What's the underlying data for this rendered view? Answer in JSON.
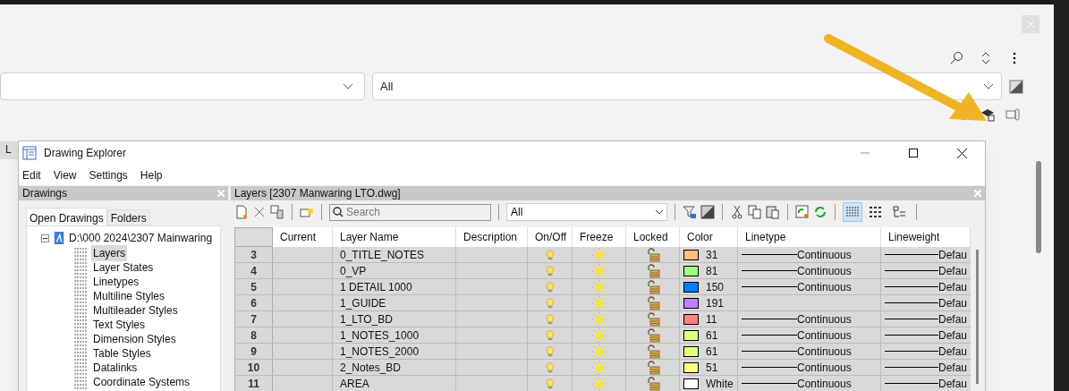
{
  "background": {
    "side_tab": "L",
    "dropdown_2": "All"
  },
  "window": {
    "title": "Drawing Explorer",
    "menu": [
      "Edit",
      "View",
      "Settings",
      "Help"
    ]
  },
  "drawings_pane": {
    "title": "Drawings",
    "tabs": [
      {
        "label": "Open Drawings",
        "selected": true
      },
      {
        "label": "Folders",
        "selected": false
      }
    ],
    "tree": [
      {
        "label": "D:\\000 2024\\2307 Mainwaring",
        "expanded": true,
        "children": [
          {
            "label": "Layers",
            "selected": true
          },
          {
            "label": "Layer States",
            "selected": false
          },
          {
            "label": "Linetypes",
            "selected": false
          },
          {
            "label": "Multiline Styles",
            "selected": false
          },
          {
            "label": "Multileader Styles",
            "selected": false
          },
          {
            "label": "Text Styles",
            "selected": false
          },
          {
            "label": "Dimension Styles",
            "selected": false
          },
          {
            "label": "Table Styles",
            "selected": false
          },
          {
            "label": "Datalinks",
            "selected": false
          },
          {
            "label": "Coordinate Systems",
            "selected": false
          }
        ]
      }
    ]
  },
  "layers_pane": {
    "title": "Layers [2307 Manwaring LTO.dwg]",
    "search": {
      "placeholder": "Search"
    },
    "filter": "All",
    "views": [
      {
        "kind": "details",
        "selected": true
      },
      {
        "kind": "icons",
        "selected": false
      },
      {
        "kind": "tree",
        "selected": false
      }
    ],
    "columns": [
      "Current",
      "Layer Name",
      "Description",
      "On/Off",
      "Freeze",
      "Locked",
      "Color",
      "Linetype",
      "Lineweight"
    ],
    "rows": [
      {
        "number": "3",
        "name": "0_TITLE_NOTES",
        "color": "#ffbf80",
        "color_label": "31",
        "linetype": "Continuous",
        "lineweight": "Defau"
      },
      {
        "number": "4",
        "name": "0_VP",
        "color": "#a0ff80",
        "color_label": "81",
        "linetype": "Continuous",
        "lineweight": "Defau"
      },
      {
        "number": "5",
        "name": "1 DETAIL 1000",
        "color": "#0080ff",
        "color_label": "150",
        "linetype": "Continuous",
        "lineweight": "Defau"
      },
      {
        "number": "6",
        "name": "1_GUIDE",
        "color": "#bf80ff",
        "color_label": "191",
        "linetype": "",
        "lineweight": "Defau"
      },
      {
        "number": "7",
        "name": "1_LTO_BD",
        "color": "#ff8080",
        "color_label": "11",
        "linetype": "Continuous",
        "lineweight": "Defau"
      },
      {
        "number": "8",
        "name": "1_NOTES_1000",
        "color": "#dfff80",
        "color_label": "61",
        "linetype": "Continuous",
        "lineweight": "Defau"
      },
      {
        "number": "9",
        "name": "1_NOTES_2000",
        "color": "#dfff80",
        "color_label": "61",
        "linetype": "Continuous",
        "lineweight": "Defau"
      },
      {
        "number": "10",
        "name": "2_Notes_BD",
        "color": "#ffff80",
        "color_label": "51",
        "linetype": "Continuous",
        "lineweight": "Defau"
      },
      {
        "number": "11",
        "name": "AREA",
        "color": "#ffffff",
        "color_label": "White",
        "linetype": "Continuous",
        "lineweight": "Defau"
      }
    ]
  }
}
